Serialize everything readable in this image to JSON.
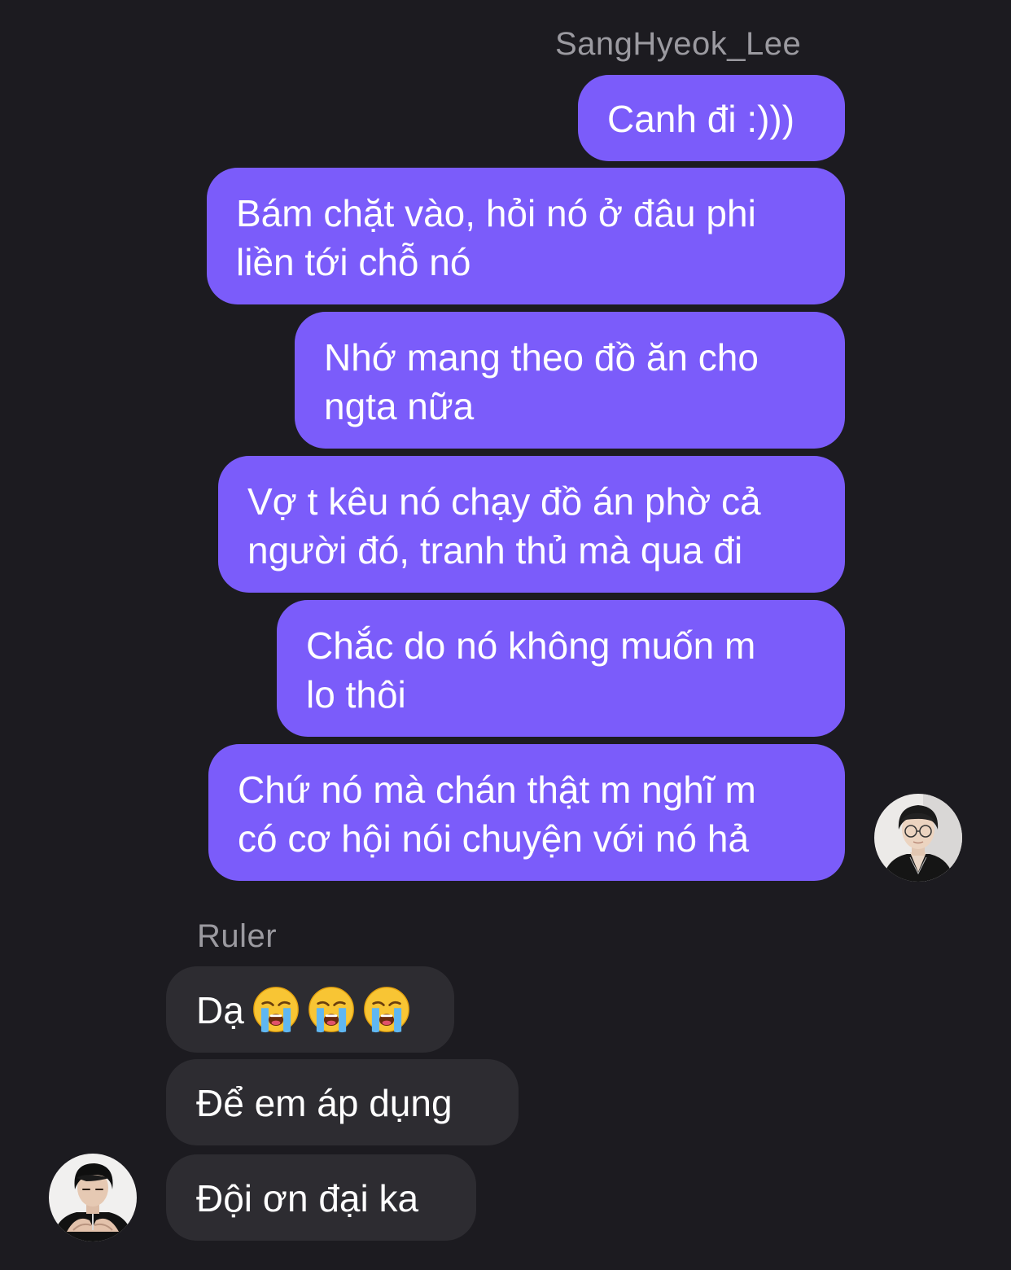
{
  "conversation": {
    "outgoing_sender": "SangHyeok_Lee",
    "outgoing_messages": [
      "Canh đi :)))",
      "Bám chặt vào, hỏi nó ở đâu phi\nliền tới chỗ nó",
      "Nhớ mang theo đồ ăn cho\nngta nữa",
      "Vợ t kêu nó chạy đồ án phờ cả\nngười đó, tranh thủ mà qua đi",
      "Chắc do nó không muốn m\nlo thôi",
      "Chứ nó mà chán thật m nghĩ m\ncó cơ hội nói chuyện với nó hả"
    ],
    "incoming_sender": "Ruler",
    "incoming_messages": [
      "Dạ",
      "Để em áp dụng",
      "Đội ơn đại ka"
    ],
    "emoji_reaction": "loudly-crying-face-icon",
    "colors": {
      "background": "#1c1b20",
      "outgoing_bubble": "#7b5cfa",
      "incoming_bubble": "#2d2c31",
      "sender_name": "#9b9aa0"
    }
  }
}
